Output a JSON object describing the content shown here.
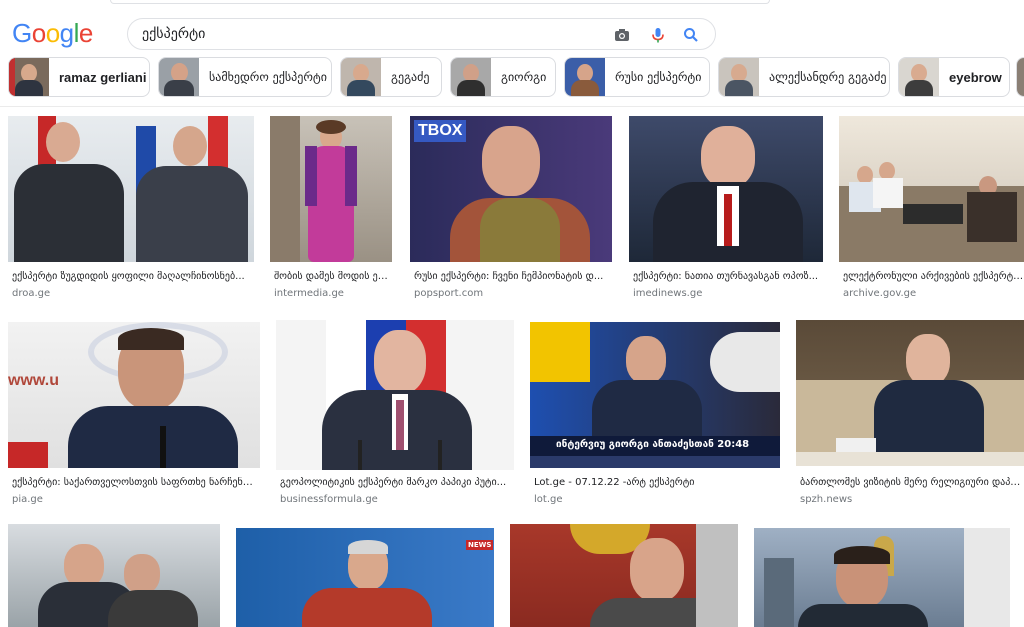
{
  "search": {
    "query": "ექსპერტი"
  },
  "logo": "Google",
  "chips": [
    {
      "label": "ramaz gerliani"
    },
    {
      "label": "სამხედრო ექსპერტი"
    },
    {
      "label": "გეგაძე"
    },
    {
      "label": "გიორგი"
    },
    {
      "label": "რუსი ექსპერტი"
    },
    {
      "label": "ალექსანდრე გეგაძე"
    },
    {
      "label": "eyebrow"
    }
  ],
  "results": [
    {
      "caption": "ექსპერტი ზუგდიდის ყოფილი მაღალჩინოსნებ...",
      "source": "droa.ge"
    },
    {
      "caption": "შობის დამეს მოდის ექ...",
      "source": "intermedia.ge"
    },
    {
      "caption": "რუსი ექსპერტი: ჩვენი ჩემპიონატის დ...",
      "source": "popsport.com",
      "overlay": "TBOX"
    },
    {
      "caption": "ექსპერტი: ნათია თურნავასგან ოპოზ...",
      "source": "imedinews.ge"
    },
    {
      "caption": "ელექტრონული არქივების ექსპერტი ძ...",
      "source": "archive.gov.ge"
    },
    {
      "caption": "ექსპერტი: საქართველოსთვის საფრთხე ნარჩენდ...",
      "source": "pia.ge",
      "overlay": "www.u"
    },
    {
      "caption": "გეოპოლიტიკის ექსპერტი მარკო პაპიკი პუტი...",
      "source": "businessformula.ge"
    },
    {
      "caption": "Lot.ge - 07.12.22 -არტ ექსპერტი",
      "source": "lot.ge",
      "banner": "ინტერვიუ გიორგი ანთაძესთან 20:48"
    },
    {
      "caption": "ბართლომეს ვიზიტის მერე რელიგიური დაპა...",
      "source": "spzh.news"
    },
    {
      "caption": "",
      "source": ""
    },
    {
      "caption": "",
      "source": "",
      "overlay": "NEWS"
    },
    {
      "caption": "",
      "source": ""
    },
    {
      "caption": "",
      "source": ""
    }
  ]
}
